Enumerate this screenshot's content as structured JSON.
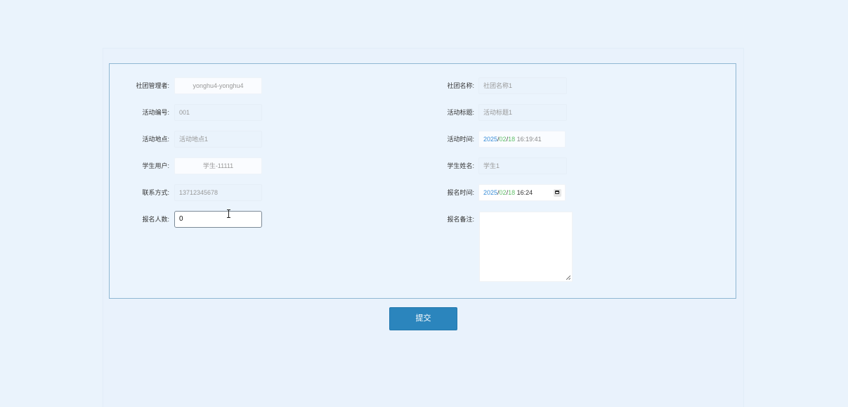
{
  "form": {
    "left": [
      {
        "label": "社团管理者:",
        "value": "yonghu4-yonghu4"
      },
      {
        "label": "活动编号:",
        "value": "001"
      },
      {
        "label": "活动地点:",
        "value": "活动地点1"
      },
      {
        "label": "学生用户:",
        "value": "学生-11111"
      },
      {
        "label": "联系方式:",
        "value": "13712345678"
      },
      {
        "label": "报名人数:",
        "value": "0"
      }
    ],
    "right": [
      {
        "label": "社团名称:",
        "value": "社团名称1"
      },
      {
        "label": "活动标题:",
        "value": "活动标题1"
      },
      {
        "label": "活动时间:",
        "date_y": "2025",
        "date_sep1": "/",
        "date_m": "02",
        "date_sep2": "/",
        "date_d": "18",
        "time": " 16:19:41"
      },
      {
        "label": "学生姓名:",
        "value": "学生1"
      },
      {
        "label": "报名时间:",
        "date_y": "2025",
        "date_sep1": "/",
        "date_m": "02",
        "date_sep2": "/",
        "date_d": "18",
        "time": " 16:24"
      },
      {
        "label": "报名备注:",
        "value": ""
      }
    ]
  },
  "submit_label": "提交",
  "icons": {
    "calendar": "calendar-icon",
    "text_cursor": "text-cursor-icon"
  },
  "colors": {
    "background": "#eaf3fc",
    "form_border": "#8fb7d3",
    "button": "#2b85bd"
  }
}
